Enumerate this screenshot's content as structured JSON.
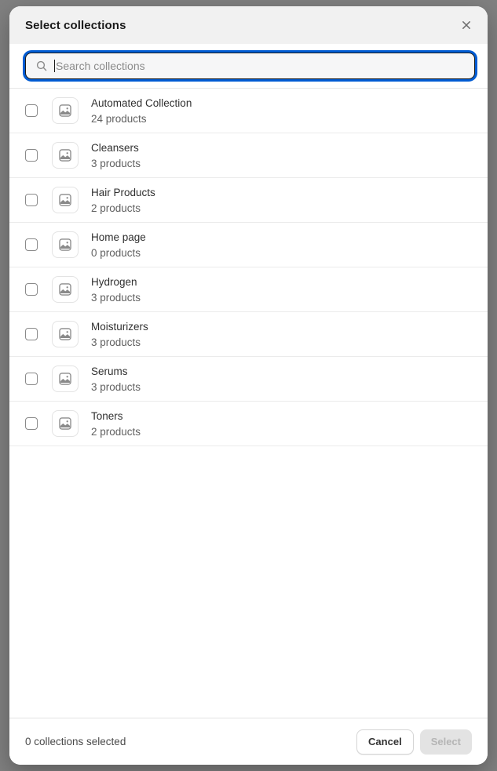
{
  "modal": {
    "title": "Select collections",
    "close_icon": "close-icon"
  },
  "search": {
    "placeholder": "Search collections",
    "value": "",
    "icon": "search-icon"
  },
  "list": {
    "item_thumb_icon": "image-placeholder-icon",
    "items": [
      {
        "title": "Automated Collection",
        "subtitle": "24 products",
        "checked": false
      },
      {
        "title": "Cleansers",
        "subtitle": "3 products",
        "checked": false
      },
      {
        "title": "Hair Products",
        "subtitle": "2 products",
        "checked": false
      },
      {
        "title": "Home page",
        "subtitle": "0 products",
        "checked": false
      },
      {
        "title": "Hydrogen",
        "subtitle": "3 products",
        "checked": false
      },
      {
        "title": "Moisturizers",
        "subtitle": "3 products",
        "checked": false
      },
      {
        "title": "Serums",
        "subtitle": "3 products",
        "checked": false
      },
      {
        "title": "Toners",
        "subtitle": "2 products",
        "checked": false
      }
    ]
  },
  "footer": {
    "status": "0 collections selected",
    "cancel_label": "Cancel",
    "select_label": "Select"
  },
  "colors": {
    "backdrop": "#808080",
    "surface": "#ffffff",
    "header_bg": "#f1f1f1",
    "focus_ring": "#005bd3",
    "text_primary": "#303030",
    "text_secondary": "#616161",
    "divider": "#ebebeb",
    "disabled_bg": "#e3e3e3",
    "disabled_text": "#b5b5b5"
  }
}
